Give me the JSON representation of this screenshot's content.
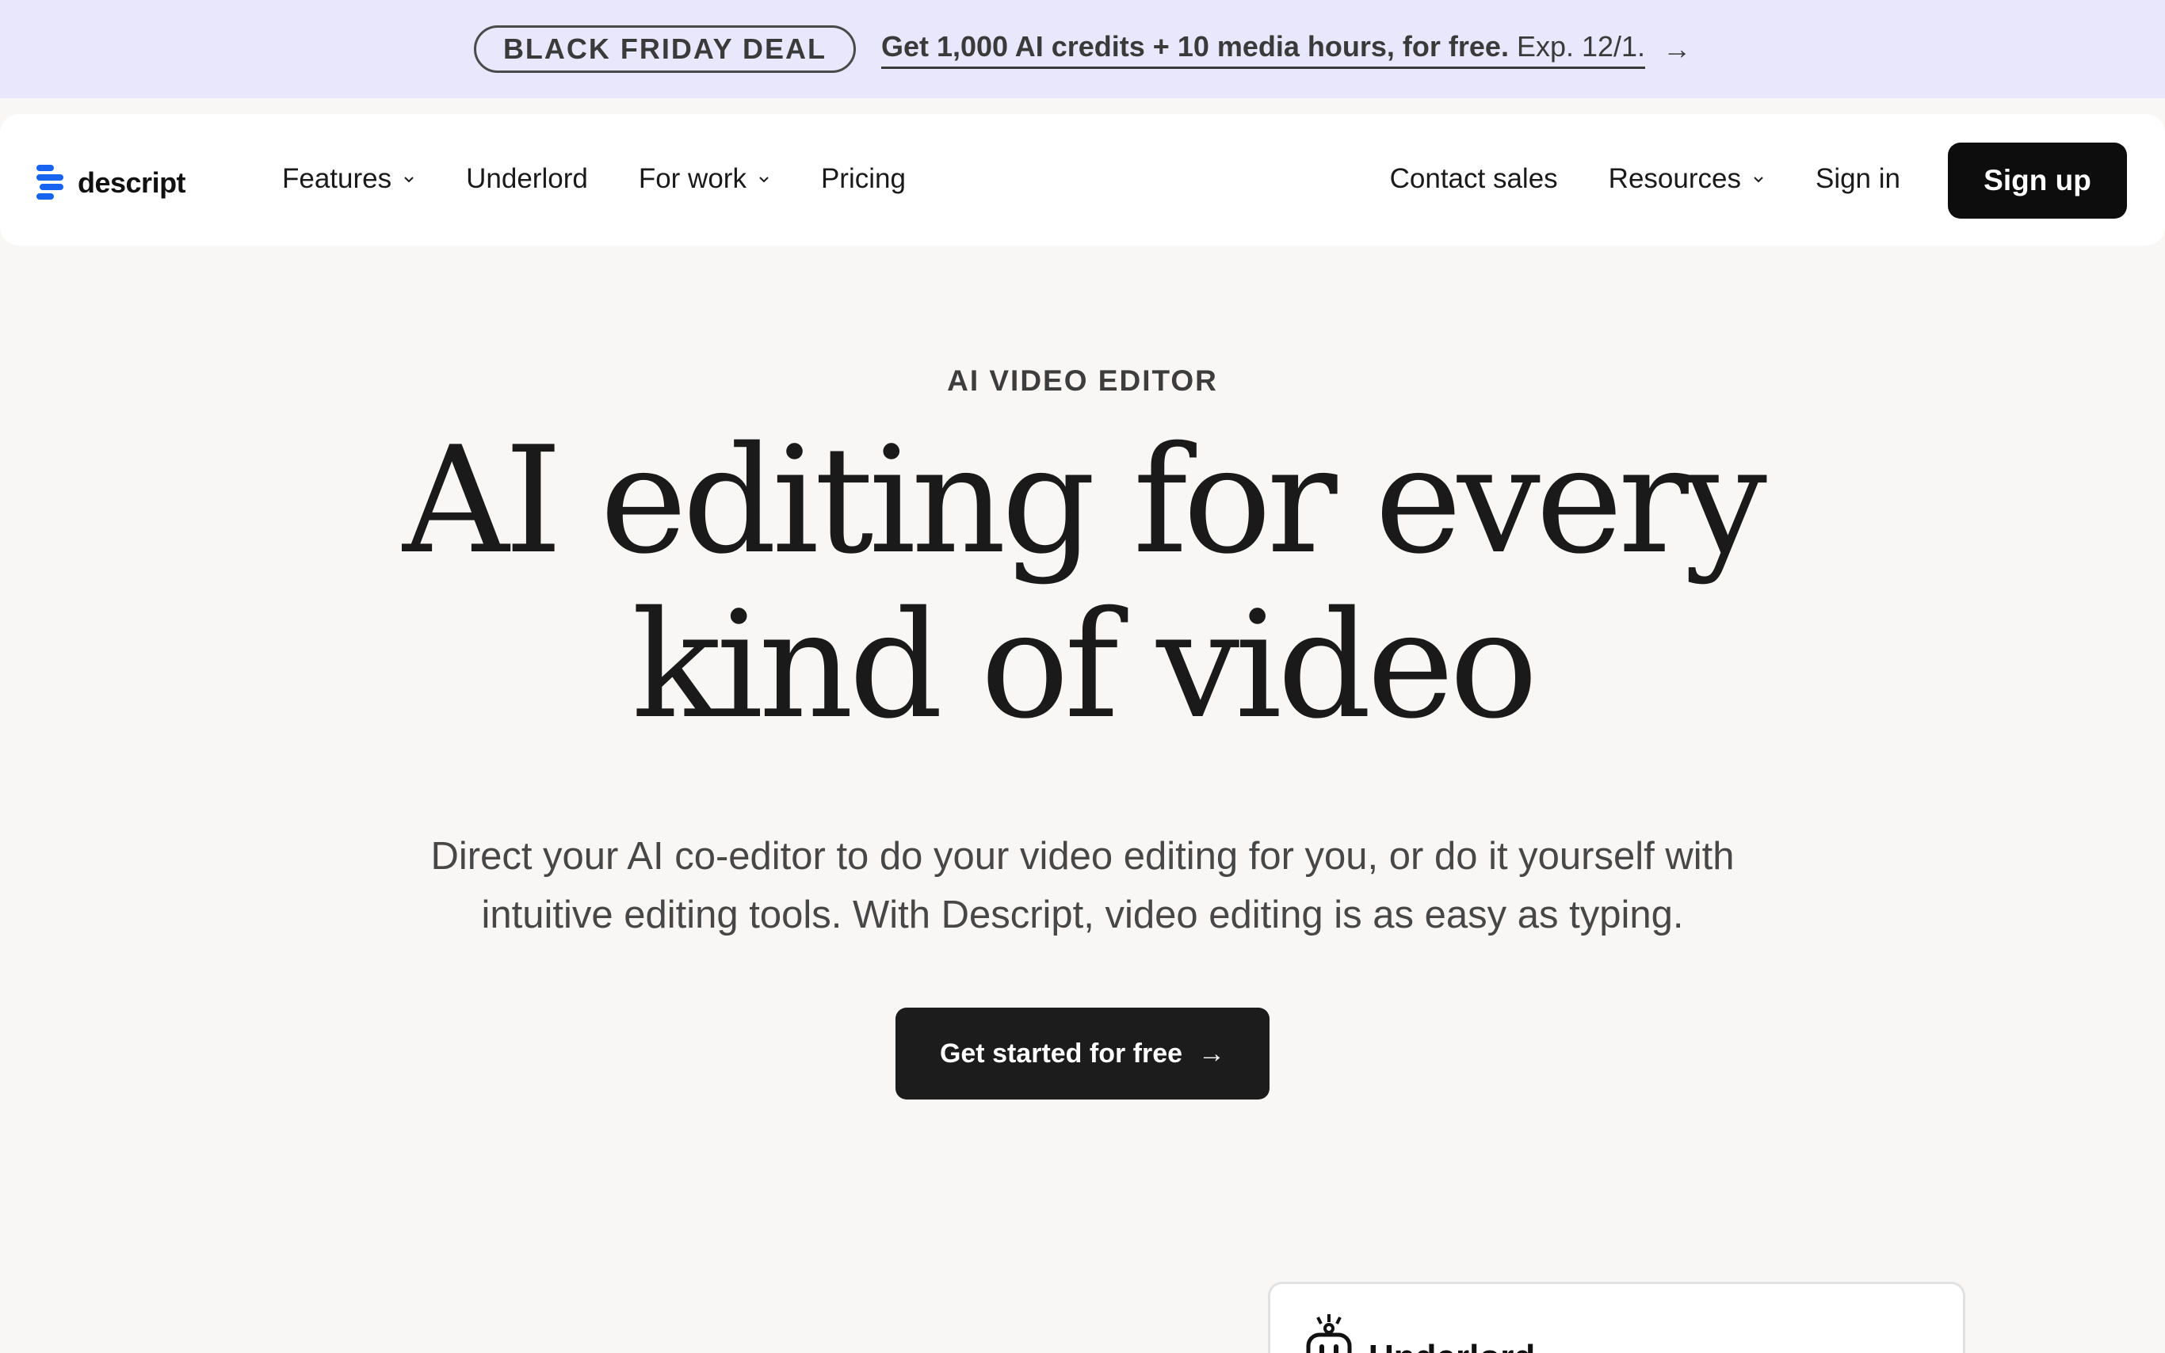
{
  "promo": {
    "badge": "BLACK FRIDAY DEAL",
    "offer_bold": "Get 1,000 AI credits + 10 media hours, for free.",
    "offer_rest": " Exp. 12/1.",
    "arrow": "→"
  },
  "nav": {
    "logo_text": "descript",
    "left_items": [
      {
        "label": "Features",
        "has_dropdown": true
      },
      {
        "label": "Underlord",
        "has_dropdown": false
      },
      {
        "label": "For work",
        "has_dropdown": true
      },
      {
        "label": "Pricing",
        "has_dropdown": false
      }
    ],
    "right_items": [
      {
        "label": "Contact sales",
        "has_dropdown": false
      },
      {
        "label": "Resources",
        "has_dropdown": true
      },
      {
        "label": "Sign in",
        "has_dropdown": false
      }
    ],
    "signup_label": "Sign up"
  },
  "hero": {
    "eyebrow": "AI VIDEO EDITOR",
    "headline_line1": "AI editing for every",
    "headline_line2": "kind of video",
    "subhead_line1": "Direct your AI co-editor to do your video editing for you, or do it yourself with",
    "subhead_line2": "intuitive editing tools. With Descript, video editing is as easy as typing.",
    "cta_label": "Get started for free",
    "cta_arrow": "→"
  },
  "card": {
    "title": "Underlord",
    "icon": "robot-icon"
  },
  "colors": {
    "promo_bg": "#e8e7fb",
    "page_bg": "#f8f7f5",
    "brand_blue": "#1863f0",
    "button_dark": "#0d0d0d"
  }
}
